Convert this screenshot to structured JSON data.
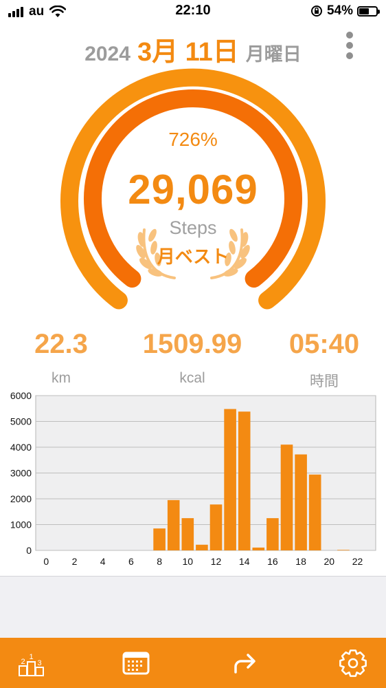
{
  "status_bar": {
    "carrier": "au",
    "time": "22:10",
    "battery_percent": "54%",
    "battery_level": 0.54,
    "icons": [
      "signal-icon",
      "wifi-icon",
      "orientation-lock-icon",
      "battery-icon"
    ]
  },
  "header": {
    "year": "2024",
    "month_day": "3月 11日",
    "weekday": "月曜日",
    "menu_icon": "more-vertical-icon"
  },
  "summary": {
    "percent": "726%",
    "steps": "29,069",
    "steps_label": "Steps",
    "badge": "月ベスト",
    "outer_ring_progress": 1.0,
    "inner_ring_progress": 1.0
  },
  "stats": [
    {
      "value": "22.3",
      "unit": "km"
    },
    {
      "value": "1509.99",
      "unit": "kcal"
    },
    {
      "value": "05:40",
      "unit": "時間"
    }
  ],
  "colors": {
    "accent": "#f38a12",
    "ring_outer": "#f7920f",
    "ring_inner": "#f46f06",
    "laurel": "#f8c27e",
    "muted_text": "#9c9c9c",
    "stat_value": "#f5a54a",
    "chart_bg": "#efeff0"
  },
  "chart_data": {
    "type": "bar",
    "x": [
      0,
      1,
      2,
      3,
      4,
      5,
      6,
      7,
      8,
      9,
      10,
      11,
      12,
      13,
      14,
      15,
      16,
      17,
      18,
      19,
      20,
      21,
      22,
      23
    ],
    "values": [
      0,
      0,
      0,
      0,
      0,
      0,
      0,
      0,
      850,
      1950,
      1250,
      220,
      1780,
      5480,
      5380,
      110,
      1250,
      4100,
      3720,
      2940,
      0,
      20,
      0,
      0
    ],
    "ylim": [
      0,
      6000
    ],
    "yticks": [
      "0",
      "1000",
      "2000",
      "3000",
      "4000",
      "5000",
      "6000"
    ],
    "xticks": [
      "0",
      "2",
      "4",
      "6",
      "8",
      "10",
      "12",
      "14",
      "16",
      "18",
      "20",
      "22"
    ],
    "grid": true,
    "color": "#f38a12"
  },
  "tabbar": {
    "tabs": [
      {
        "name": "ranking",
        "icon": "ranking-podium-icon"
      },
      {
        "name": "calendar",
        "icon": "calendar-icon"
      },
      {
        "name": "share",
        "icon": "share-arrow-icon"
      },
      {
        "name": "settings",
        "icon": "gear-icon"
      }
    ]
  }
}
